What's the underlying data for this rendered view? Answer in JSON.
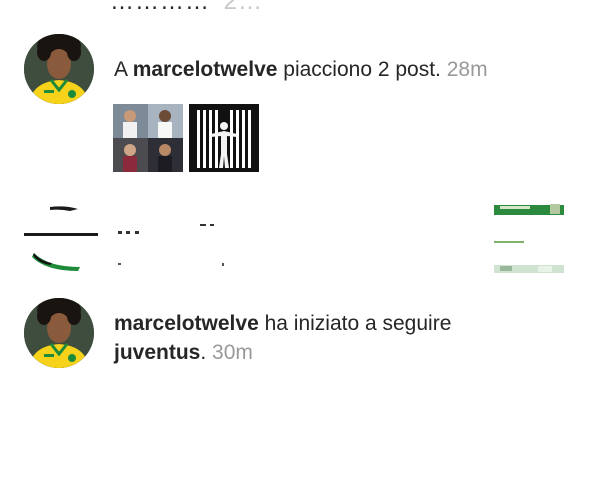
{
  "cut_row": {
    "text": "…………",
    "time": "2…"
  },
  "notifications": [
    {
      "username": "marcelotwelve",
      "action": " piacciono 2 post.",
      "prefix": "A ",
      "time": "28m",
      "avatar_icon": "profile-photo-marcelo",
      "posts": [
        {
          "icon": "photo-collage-thumbnail"
        },
        {
          "icon": "cristiano-jersey-thumbnail"
        }
      ]
    },
    {
      "username": "marcelotwelve",
      "action": " ha iniziato a seguire",
      "target": "juventus",
      "suffix": ".",
      "time": "30m",
      "avatar_icon": "profile-photo-marcelo"
    }
  ],
  "colors": {
    "text": "#262626",
    "time": "#999999",
    "brazil_yellow": "#f6d31a",
    "brazil_green": "#1f8a3a"
  }
}
